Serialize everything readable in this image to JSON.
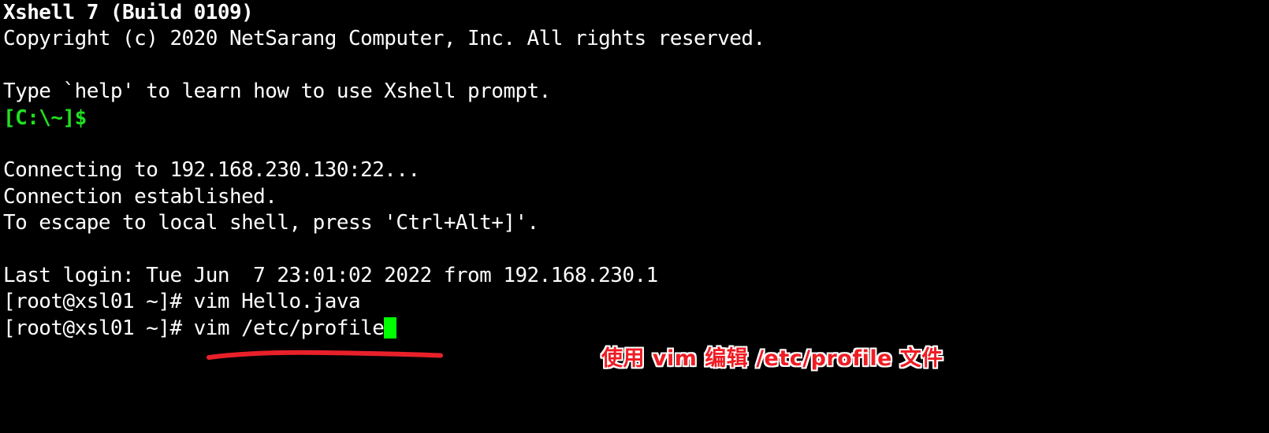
{
  "terminal": {
    "background_color": "#000000",
    "text_color": "#ffffff",
    "prompt_color": "#20e020",
    "cursor_color": "#00ff00",
    "lines": [
      {
        "text": "Xshell 7 (Build 0109)",
        "style": "bold"
      },
      {
        "text": "Copyright (c) 2020 NetSarang Computer, Inc. All rights reserved.",
        "style": "normal"
      },
      {
        "text": "",
        "style": "blank"
      },
      {
        "text": "Type `help' to learn how to use Xshell prompt.",
        "style": "normal"
      },
      {
        "text": "[C:\\~]$",
        "style": "prompt"
      },
      {
        "text": "",
        "style": "blank"
      },
      {
        "text": "Connecting to 192.168.230.130:22...",
        "style": "normal"
      },
      {
        "text": "Connection established.",
        "style": "normal"
      },
      {
        "text": "To escape to local shell, press 'Ctrl+Alt+]'.",
        "style": "normal"
      },
      {
        "text": "",
        "style": "blank"
      },
      {
        "text": "Last login: Tue Jun  7 23:01:02 2022 from 192.168.230.1",
        "style": "normal"
      },
      {
        "text": "[root@xsl01 ~]# vim Hello.java",
        "style": "normal"
      },
      {
        "text": "[root@xsl01 ~]# vim /etc/profile",
        "style": "cursor"
      }
    ]
  },
  "lines_text": {
    "l0": "Xshell 7 (Build 0109)",
    "l1": "Copyright (c) 2020 NetSarang Computer, Inc. All rights reserved.",
    "l2": "",
    "l3": "Type `help' to learn how to use Xshell prompt.",
    "l4": "[C:\\~]$",
    "l5": "",
    "l6": "Connecting to 192.168.230.130:22...",
    "l7": "Connection established.",
    "l8": "To escape to local shell, press 'Ctrl+Alt+]'.",
    "l9": "",
    "l10": "Last login: Tue Jun  7 23:01:02 2022 from 192.168.230.1",
    "l11": "[root@xsl01 ~]# vim Hello.java",
    "l12": "[root@xsl01 ~]# vim /etc/profile"
  },
  "annotation": {
    "text": "使用 vim 编辑 /etc/profile 文件",
    "color": "#ef1c24",
    "outline_color": "#ffffff"
  },
  "underline": {
    "color": "#e8202a",
    "name": "red-underline-marker"
  },
  "session": {
    "host": "192.168.230.130",
    "port": "22",
    "user": "root",
    "hostname": "xsl01",
    "last_login_from": "192.168.230.1",
    "last_login_time": "Tue Jun  7 23:01:02 2022"
  }
}
